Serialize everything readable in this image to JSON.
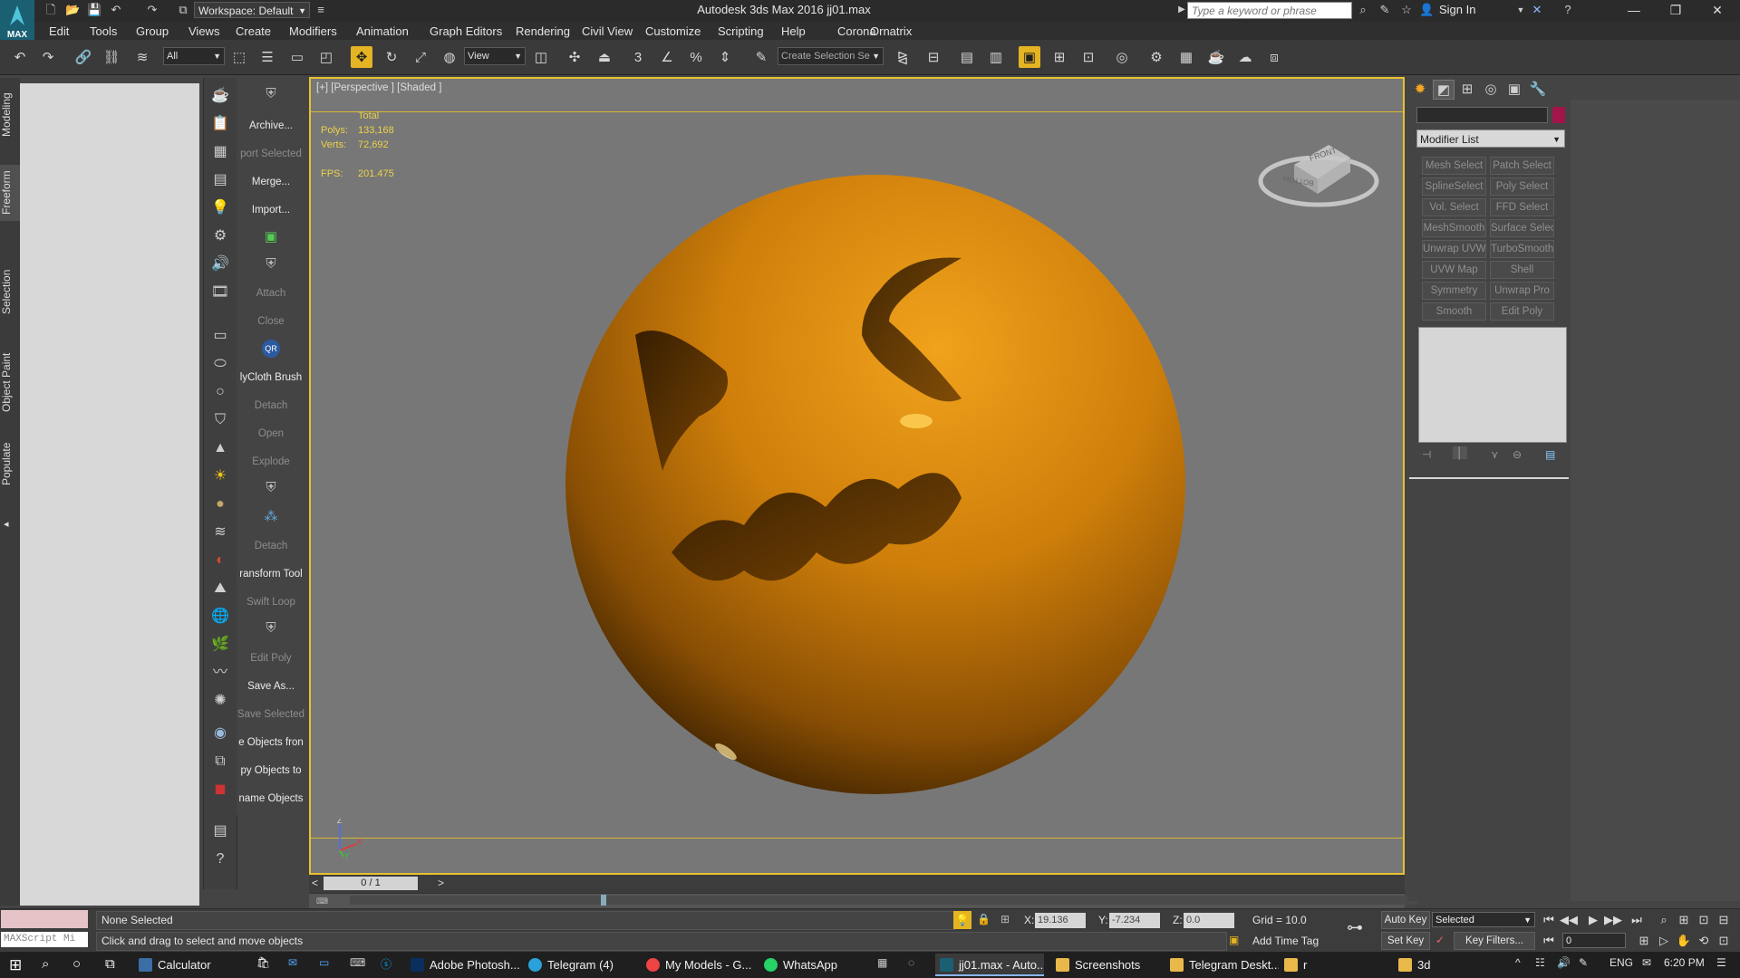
{
  "titlebar": {
    "workspace": "Workspace: Default",
    "title": "Autodesk 3ds Max 2016     jj01.max",
    "search_placeholder": "Type a keyword or phrase",
    "signin": "Sign In",
    "logo": "MAX"
  },
  "menu": [
    "Edit",
    "Tools",
    "Group",
    "Views",
    "Create",
    "Modifiers",
    "Animation",
    "Graph Editors",
    "Rendering",
    "Civil View",
    "Customize",
    "Scripting",
    "Help",
    "Corona",
    "Ornatrix"
  ],
  "toolbar": {
    "filter": "All",
    "ref_coord": "View",
    "selection_set_placeholder": "Create Selection Se"
  },
  "ribbon_tabs": [
    "Modeling",
    "Freeform",
    "Selection",
    "Object Paint",
    "Populate"
  ],
  "script_items": [
    {
      "label": "Archive...",
      "dim": false
    },
    {
      "label": "port Selected",
      "dim": true
    },
    {
      "label": "Merge...",
      "dim": false
    },
    {
      "label": "Import...",
      "dim": false
    },
    {
      "label": "Attach",
      "dim": true
    },
    {
      "label": "Close",
      "dim": true
    },
    {
      "label": "lyCloth Brush",
      "dim": false
    },
    {
      "label": "Detach",
      "dim": true
    },
    {
      "label": "Open",
      "dim": true
    },
    {
      "label": "Explode",
      "dim": true
    },
    {
      "label": "Detach",
      "dim": true
    },
    {
      "label": "ransform Tool",
      "dim": false
    },
    {
      "label": "Swift Loop",
      "dim": true
    },
    {
      "label": "Edit Poly",
      "dim": true
    },
    {
      "label": "Save As...",
      "dim": false
    },
    {
      "label": "Save Selected",
      "dim": true
    },
    {
      "label": "e Objects fron",
      "dim": false
    },
    {
      "label": "py Objects to",
      "dim": false
    },
    {
      "label": "name Objects",
      "dim": false
    }
  ],
  "viewport": {
    "label": "[+] [Perspective ] [Shaded ]",
    "stats": {
      "total_label": "Total",
      "polys_label": "Polys:",
      "polys": "133,168",
      "verts_label": "Verts:",
      "verts": "72,692",
      "fps_label": "FPS:",
      "fps": "201.475"
    },
    "viewcube": {
      "front": "FRONT",
      "bottom": "BOTTOM"
    },
    "axis": {
      "z": "Z",
      "x": "X",
      "y": "Y"
    }
  },
  "timeslider": {
    "frame": "0 / 1",
    "prev": "<",
    "next": ">"
  },
  "command_panel": {
    "modifier_list": "Modifier List",
    "modifiers": [
      "Mesh Select",
      "Patch Select",
      "SplineSelect",
      "Poly Select",
      "Vol. Select",
      "FFD Select",
      "MeshSmooth",
      "Surface Select",
      "Unwrap UVW",
      "TurboSmooth",
      "UVW Map",
      "Shell",
      "Symmetry",
      "Unwrap Pro",
      "Smooth",
      "Edit Poly"
    ],
    "swatch_color": "#a3144a"
  },
  "status": {
    "selection": "None Selected",
    "prompt": "Click and drag to select and move objects",
    "maxscript": "MAXScript Mi",
    "x_label": "X:",
    "x": "19.136",
    "y_label": "Y:",
    "y": "-7.234",
    "z_label": "Z:",
    "z": "0.0",
    "grid": "Grid = 10.0",
    "add_time_tag": "Add Time Tag",
    "auto_key": "Auto Key",
    "set_key": "Set Key",
    "key_mode": "Selected",
    "key_filters": "Key Filters...",
    "frame_field": "0"
  },
  "taskbar": {
    "tasks": [
      "Calculator",
      "Adobe Photosh...",
      "Telegram (4)",
      "My Models - G...",
      "WhatsApp",
      "jj01.max - Auto...",
      "Screenshots",
      "Telegram Deskt...",
      "r",
      "3d"
    ],
    "lang": "ENG",
    "time": "6:20 PM"
  },
  "colors": {
    "accent": "#e8c12c",
    "sphere": "#d0850c",
    "viewport_bg": "#777777"
  }
}
